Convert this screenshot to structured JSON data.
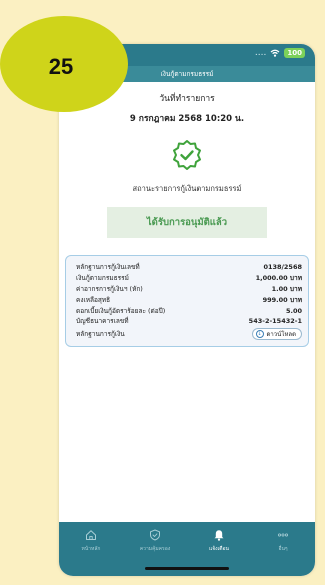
{
  "badge": {
    "number": "25"
  },
  "status_bar": {
    "dots": "....",
    "battery": "100"
  },
  "header": {
    "title": "เงินกู้ตามกรมธรรม์"
  },
  "transaction": {
    "date_label": "วันที่ทำรายการ",
    "date_value": "9 กรกฎาคม 2568 10:20 น.",
    "status_label": "สถานะรายการกู้เงินตามกรมธรรม์",
    "status_value": "ได้รับการอนุมัติแล้ว"
  },
  "details": {
    "rows": [
      {
        "label": "หลักฐานการกู้เงินเลขที่",
        "value": "0138/2568"
      },
      {
        "label": "เงินกู้ตามกรมธรรม์",
        "value": "1,000.00 บาท"
      },
      {
        "label": "ค่าอากรการกู้เงินฯ (หัก)",
        "value": "1.00 บาท"
      },
      {
        "label": "คงเหลือสุทธิ",
        "value": "999.00 บาท"
      },
      {
        "label": "ดอกเบี้ยเงินกู้อัตราร้อยละ (ต่อปี)",
        "value": "5.00"
      },
      {
        "label": "บัญชีธนาคารเลขที่",
        "value": "543-2-15432-1"
      }
    ],
    "proof_label": "หลักฐานการกู้เงิน",
    "download_label": "ดาวน์โหลด"
  },
  "tabs": [
    {
      "label": "หน้าหลัก",
      "icon": "home-icon"
    },
    {
      "label": "ความคุ้มครอง",
      "icon": "shield-check-icon"
    },
    {
      "label": "แจ้งเตือน",
      "icon": "bell-icon"
    },
    {
      "label": "อื่นๆ",
      "icon": "more-icon"
    }
  ],
  "colors": {
    "primary": "#2b7a8b",
    "badge": "#cfd41a",
    "success": "#4a9a52",
    "background": "#fbf0c2"
  }
}
